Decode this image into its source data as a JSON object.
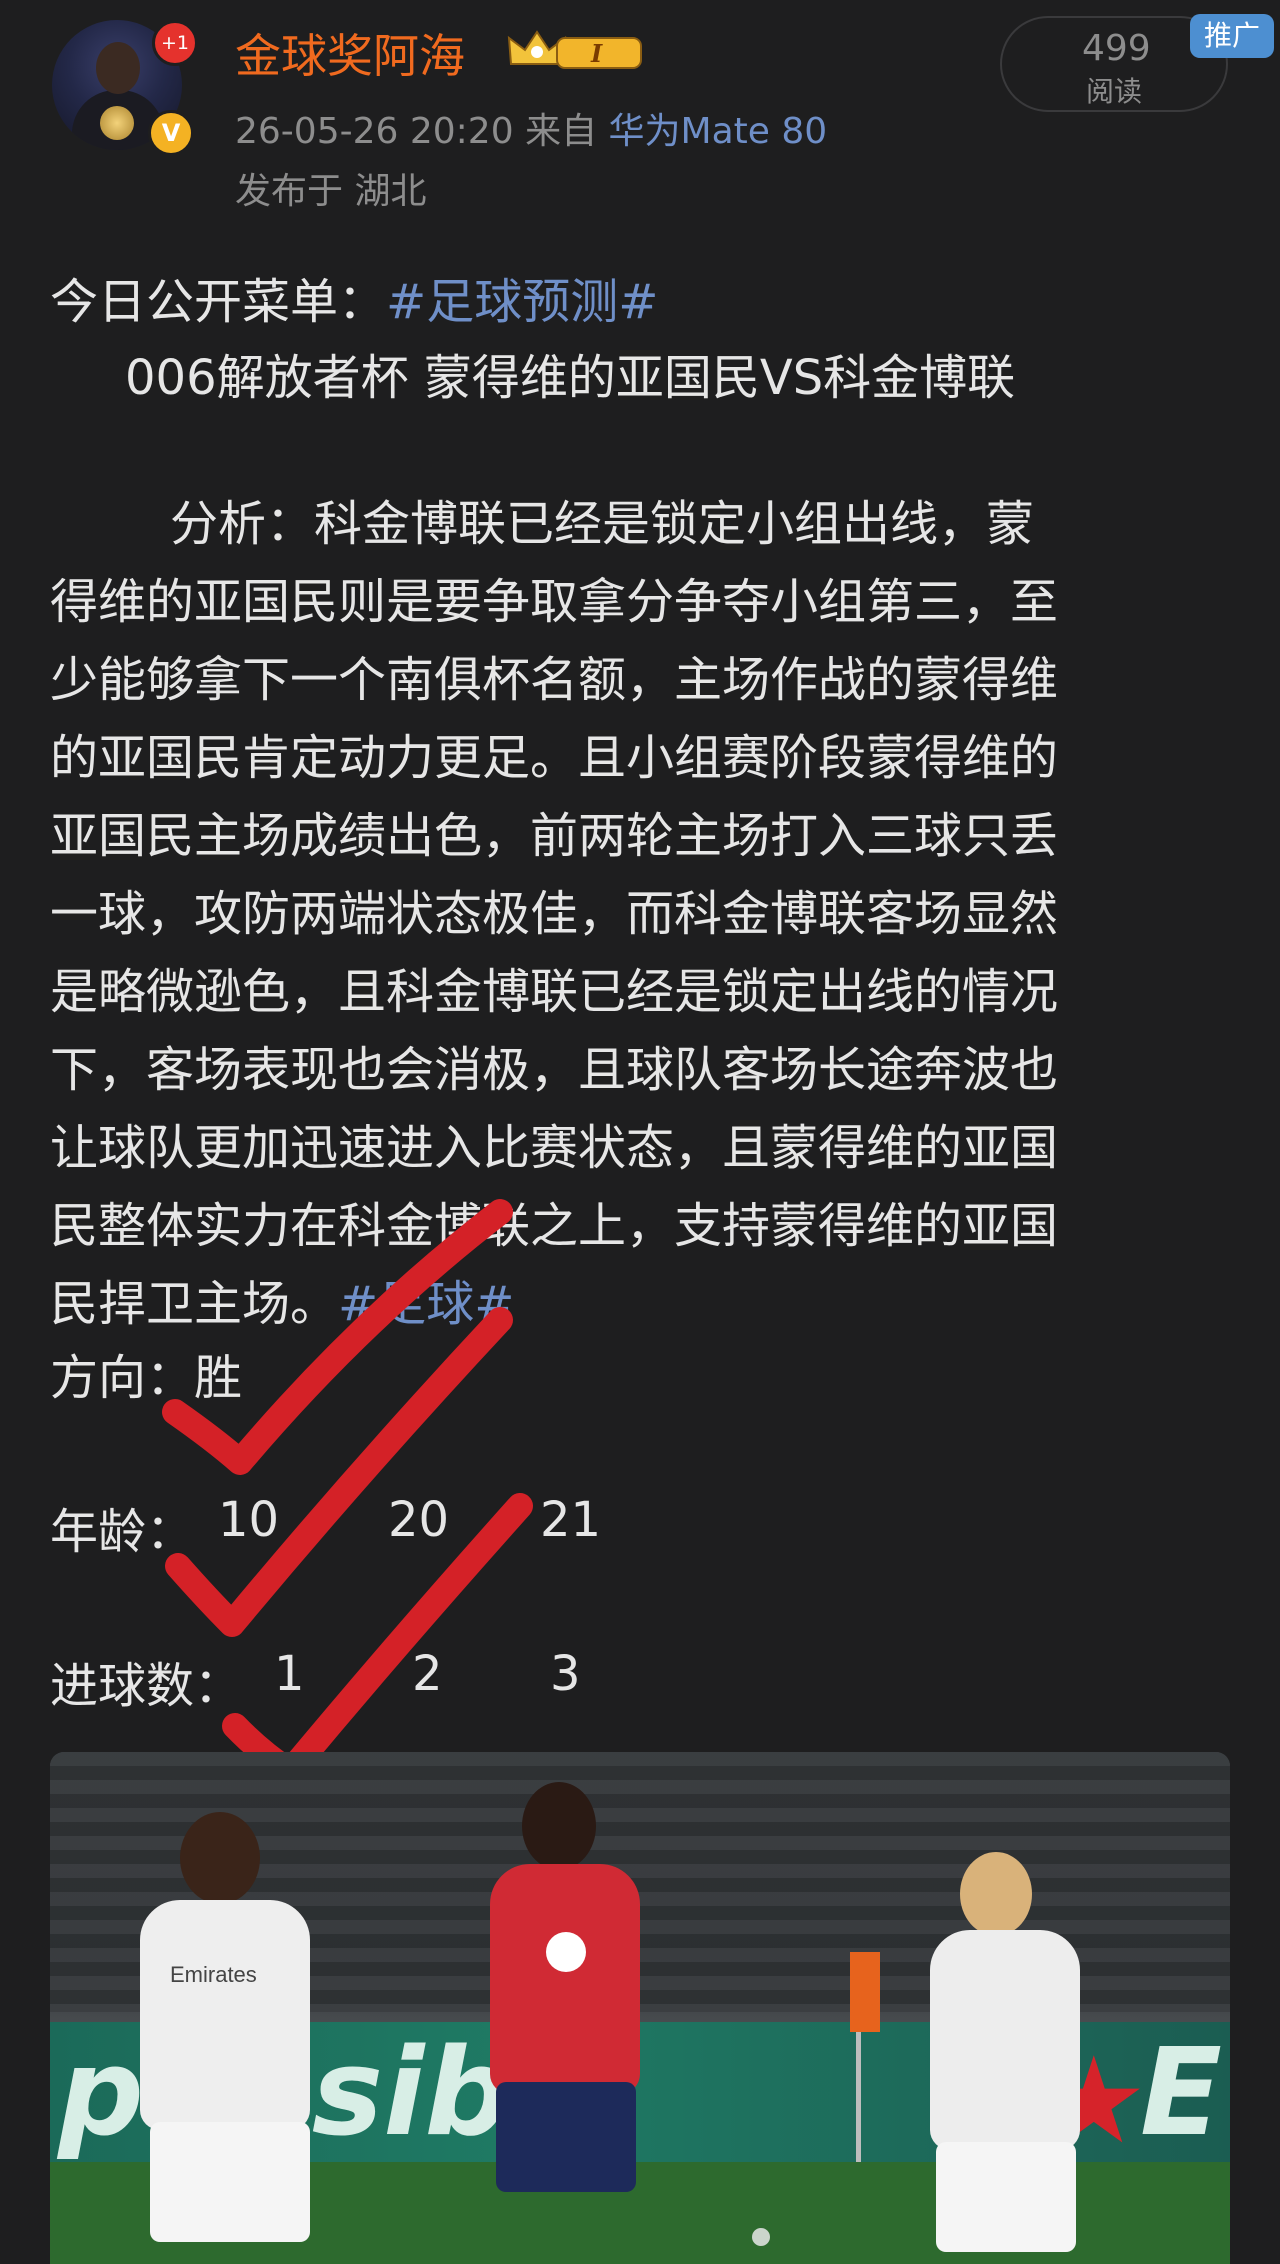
{
  "header": {
    "username": "金球奖阿海",
    "notification_badge": "+1",
    "verified_mark": "V",
    "meta_time": "26-05-26 20:20",
    "meta_from": "来自",
    "device": "华为Mate 80",
    "location": "发布于 湖北",
    "read_count": "499",
    "read_label": "阅读",
    "promo_label": "推广",
    "level_badge": "I"
  },
  "post": {
    "menu_prefix": "今日公开菜单：",
    "menu_tag": "#足球预测#",
    "match_line": "006解放者杯 蒙得维的亚国民VS科金博联",
    "analysis_lines": [
      "分析：科金博联已经是锁定小组出线，蒙",
      "得维的亚国民则是要争取拿分争夺小组第三，至",
      "少能够拿下一个南俱杯名额，主场作战的蒙得维",
      "的亚国民肯定动力更足。且小组赛阶段蒙得维的",
      "亚国民主场成绩出色，前两轮主场打入三球只丢",
      "一球，攻防两端状态极佳，而科金博联客场显然",
      "是略微逊色，且科金博联已经是锁定出线的情况",
      "下，客场表现也会消极，且球队客场长途奔波也",
      "让球队更加迅速进入比赛状态，且蒙得维的亚国",
      "民整体实力在科金博联之上，支持蒙得维的亚国"
    ],
    "analysis_last": "民捍卫主场。",
    "footer_tag": "#足球#",
    "direction_label": "方向：",
    "direction_value": "胜",
    "age_label": "年龄：",
    "age_values": [
      "10",
      "20",
      "21"
    ],
    "goals_label": "进球数：",
    "goals_values": [
      "1",
      "2",
      "3"
    ]
  },
  "photo": {
    "ad_text": "ponsibly",
    "ad_text_right": "E",
    "jersey_text": "Emirates"
  },
  "colors": {
    "background": "#1e1e1f",
    "username": "#f06a1f",
    "tag": "#6f8fc8",
    "checkmark": "#d42127",
    "promo": "#4d8fd1"
  }
}
